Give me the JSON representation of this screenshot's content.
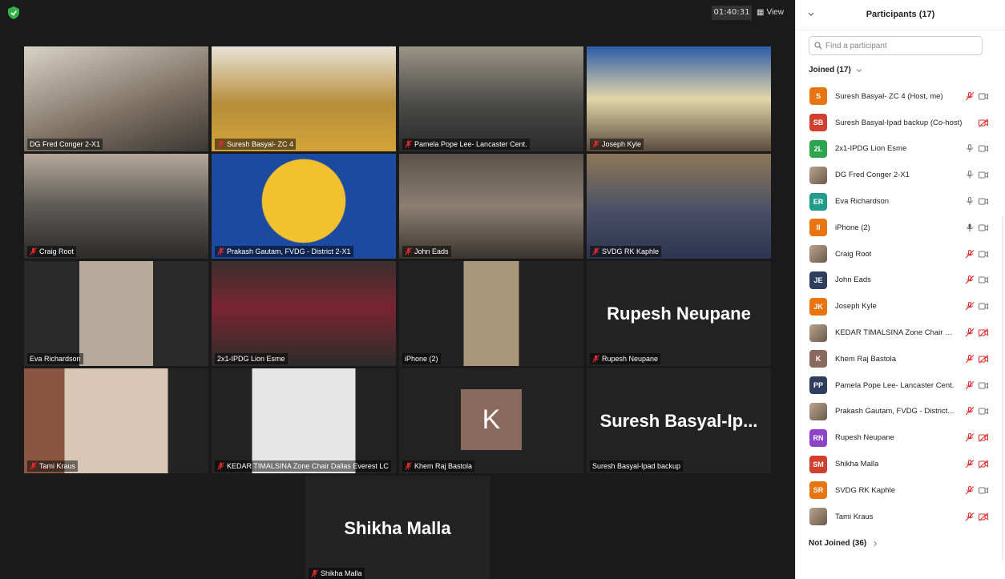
{
  "meeting": {
    "timer": "01:40:31",
    "view_label": "View"
  },
  "tiles": [
    {
      "name": "DG Fred Conger 2-X1",
      "muted": false
    },
    {
      "name": "Suresh Basyal- ZC 4",
      "muted": true
    },
    {
      "name": "Pamela Pope Lee- Lancaster Cent.",
      "muted": true
    },
    {
      "name": "Joseph Kyle",
      "muted": true
    },
    {
      "name": "Craig Root",
      "muted": true
    },
    {
      "name": "Prakash Gautam, FVDG - District 2-X1",
      "muted": true
    },
    {
      "name": "John Eads",
      "muted": true
    },
    {
      "name": "SVDG RK Kaphle",
      "muted": true
    },
    {
      "name": "Eva Richardson",
      "muted": false
    },
    {
      "name": "2x1-IPDG Lion Esme",
      "muted": false
    },
    {
      "name": "iPhone (2)",
      "muted": false
    },
    {
      "name": "Rupesh Neupane",
      "muted": true,
      "big_name": "Rupesh Neupane"
    },
    {
      "name": "Tami Kraus",
      "muted": true
    },
    {
      "name": "KEDAR TIMALSINA Zone Chair Dallas Everest LC",
      "muted": true
    },
    {
      "name": "Khem Raj Bastola",
      "muted": true,
      "avatar_letter": "K"
    },
    {
      "name": "Suresh Basyal-Ipad backup",
      "muted": false,
      "big_name": "Suresh  Basyal-Ip..."
    },
    {
      "name": "Shikha Malla",
      "muted": true,
      "big_name": "Shikha Malla"
    }
  ],
  "sidebar": {
    "title": "Participants (17)",
    "search_placeholder": "Find a participant",
    "joined_label": "Joined (17)",
    "not_joined_label": "Not Joined (36)",
    "participants": [
      {
        "initials": "S",
        "color": "#e8750f",
        "name": "Suresh Basyal- ZC 4 (Host, me)",
        "mic": "muted",
        "video": "on"
      },
      {
        "initials": "SB",
        "color": "#d0402d",
        "name": "Suresh Basyal-Ipad backup (Co-host)",
        "mic": "none",
        "video": "off"
      },
      {
        "initials": "2L",
        "color": "#2da44e",
        "name": "2x1-IPDG Lion Esme",
        "mic": "on",
        "video": "on"
      },
      {
        "initials": "",
        "color": "photo",
        "name": "DG Fred Conger 2-X1",
        "mic": "on",
        "video": "on"
      },
      {
        "initials": "ER",
        "color": "#1f9c8a",
        "name": "Eva Richardson",
        "mic": "on",
        "video": "on"
      },
      {
        "initials": "II",
        "color": "#e8750f",
        "name": "iPhone (2)",
        "mic": "active",
        "video": "on"
      },
      {
        "initials": "",
        "color": "photo",
        "name": "Craig Root",
        "mic": "muted",
        "video": "on"
      },
      {
        "initials": "JE",
        "color": "#2e3e5c",
        "name": "John Eads",
        "mic": "muted",
        "video": "on"
      },
      {
        "initials": "JK",
        "color": "#e8750f",
        "name": "Joseph Kyle",
        "mic": "muted",
        "video": "on"
      },
      {
        "initials": "",
        "color": "photo",
        "name": "KEDAR TIMALSINA Zone Chair D...",
        "mic": "muted",
        "video": "off"
      },
      {
        "initials": "K",
        "color": "#8a6a5e",
        "name": "Khem Raj Bastola",
        "mic": "muted",
        "video": "off"
      },
      {
        "initials": "PP",
        "color": "#2e3e5c",
        "name": "Pamela Pope Lee- Lancaster Cent.",
        "mic": "muted",
        "video": "on"
      },
      {
        "initials": "",
        "color": "photo",
        "name": "Prakash Gautam, FVDG - District...",
        "mic": "muted",
        "video": "on"
      },
      {
        "initials": "RN",
        "color": "#8e44c9",
        "name": "Rupesh Neupane",
        "mic": "muted",
        "video": "off"
      },
      {
        "initials": "SM",
        "color": "#d0402d",
        "name": "Shikha Malla",
        "mic": "muted",
        "video": "off"
      },
      {
        "initials": "SR",
        "color": "#e8750f",
        "name": "SVDG RK Kaphle",
        "mic": "muted",
        "video": "on"
      },
      {
        "initials": "",
        "color": "photo",
        "name": "Tami Kraus",
        "mic": "muted",
        "video": "off"
      }
    ]
  }
}
